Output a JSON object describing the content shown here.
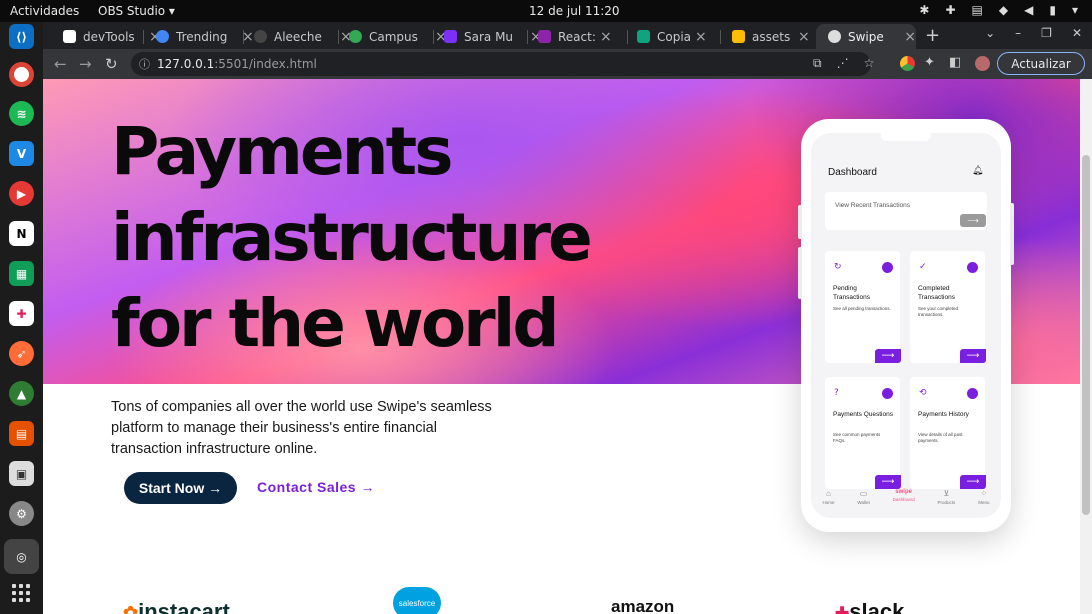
{
  "topbar": {
    "activities": "Actividades",
    "app": "OBS Studio ▾",
    "clock": "12 de jul  11:20"
  },
  "dock": {
    "icons": [
      "vscode-icon",
      "chrome-icon",
      "spotify-icon",
      "vs-icon",
      "youtube-music-icon",
      "notion-icon",
      "sheets-icon",
      "slack-icon",
      "postman-icon",
      "rocket-icon",
      "impress-icon",
      "gallery-icon",
      "settings-icon",
      "obs-icon",
      "show-apps-icon"
    ]
  },
  "browser": {
    "tabs": [
      {
        "title": "devTools",
        "color": "#ffffff"
      },
      {
        "title": "Trending",
        "color": "#4285f4"
      },
      {
        "title": "Aleeche",
        "color": "#444444"
      },
      {
        "title": "Campus",
        "color": "#34a853"
      },
      {
        "title": "Sara Mu",
        "color": "#7b2ff7"
      },
      {
        "title": "React: A",
        "color": "#8e24aa"
      },
      {
        "title": "Copia d",
        "color": "#10a37f"
      },
      {
        "title": "assets -",
        "color": "#fbbc04"
      },
      {
        "title": "Swipe",
        "color": "#dddddd"
      }
    ],
    "url_host": "127.0.0.1",
    "url_rest": ":5501/index.html",
    "update_label": "Actualizar"
  },
  "hero": {
    "title_lines": [
      "Payments",
      "infrastructure",
      "for the world"
    ],
    "description": "Tons of companies all over the world use Swipe's seamless platform to manage their business's entire financial transaction infrastructure online.",
    "start_label": "Start Now →",
    "sales_label": "Contact Sales →"
  },
  "phone": {
    "title": "Dashboard",
    "recent_label": "View Recent Transactions",
    "cards": [
      {
        "title": "Pending Transactions",
        "desc": "See all pending transactions."
      },
      {
        "title": "Completed Transactions",
        "desc": "See your completed transactions."
      },
      {
        "title": "Payments Questions",
        "desc": "See common payments FAQs."
      },
      {
        "title": "Payments History",
        "desc": "View details of all past payments."
      }
    ],
    "nav": [
      "Home",
      "Wallet",
      "Dashboard",
      "Products",
      "Menu"
    ],
    "nav_brand": "swipe"
  },
  "logos": [
    "instacart",
    "salesforce",
    "amazon",
    "slack"
  ]
}
